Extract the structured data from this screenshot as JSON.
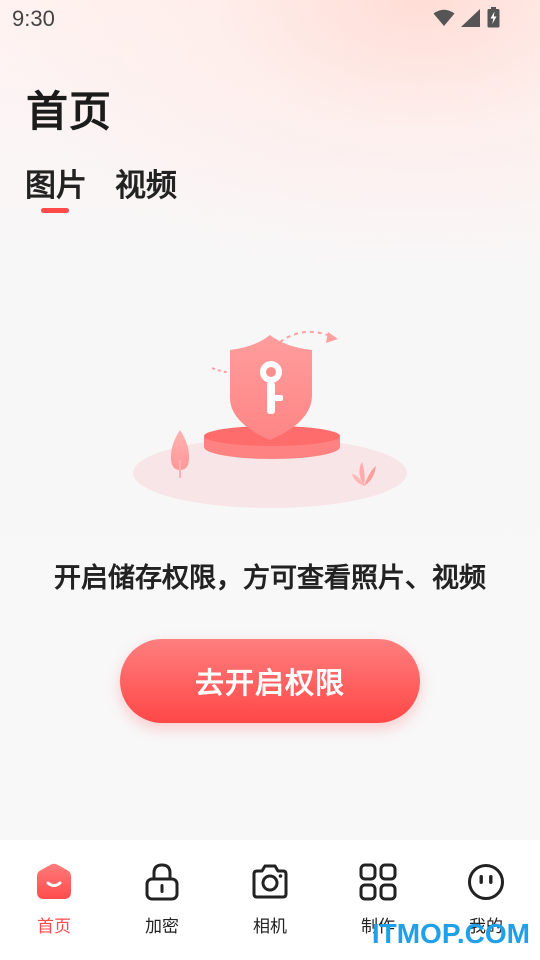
{
  "status_bar": {
    "time": "9:30",
    "icons": [
      "wifi-icon",
      "cellular-signal-icon",
      "battery-charging-icon"
    ]
  },
  "header": {
    "title": "首页"
  },
  "tabs": [
    {
      "label": "图片",
      "selected": true
    },
    {
      "label": "视频",
      "selected": false
    }
  ],
  "empty_state": {
    "illustration": "shield-key-icon",
    "message": "开启储存权限，方可查看照片、视频",
    "button_label": "去开启权限"
  },
  "bottom_nav": {
    "items": [
      {
        "label": "首页",
        "icon": "home-icon",
        "active": true
      },
      {
        "label": "加密",
        "icon": "lock-icon",
        "active": false
      },
      {
        "label": "相机",
        "icon": "camera-icon",
        "active": false
      },
      {
        "label": "制作",
        "icon": "grid-icon",
        "active": false
      },
      {
        "label": "我的",
        "icon": "smiley-face-icon",
        "active": false
      }
    ]
  },
  "watermark": "ITMOP.COM",
  "colors": {
    "accent": "#ff4a4a",
    "button_gradient_top": "#ff7f7f",
    "button_gradient_bottom": "#ff4747",
    "watermark": "#1fa0e8"
  }
}
